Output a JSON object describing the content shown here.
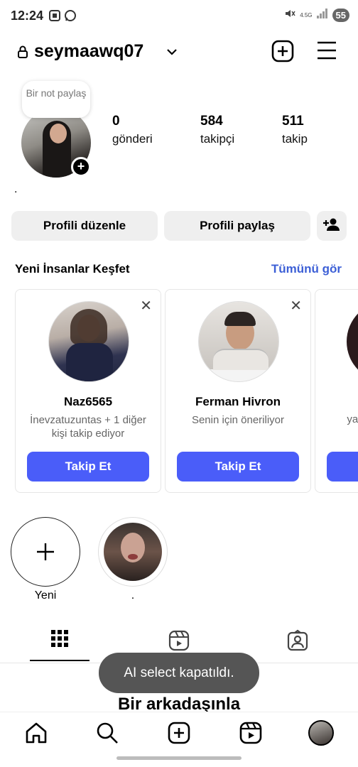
{
  "status_bar": {
    "time": "12:24",
    "network": "4.5G",
    "battery": "55"
  },
  "profile": {
    "username": "seymaawq07",
    "note": "Bir not paylaş",
    "bio": "."
  },
  "stats": [
    {
      "value": "0",
      "label": "gönderi"
    },
    {
      "value": "584",
      "label": "takipçi"
    },
    {
      "value": "511",
      "label": "takip"
    }
  ],
  "buttons": {
    "edit_profile": "Profili düzenle",
    "share_profile": "Profili paylaş"
  },
  "discover": {
    "title": "Yeni İnsanlar Keşfet",
    "see_all": "Tümünü gör",
    "cards": [
      {
        "name": "Naz6565",
        "subtitle": "İnevzatuzuntas + 1 diğer kişi takip ediyor",
        "button": "Takip Et"
      },
      {
        "name": "Ferman Hivron",
        "subtitle": "Senin için öneriliyor",
        "button": "Takip Et"
      },
      {
        "name": "",
        "subtitle": "yagz",
        "button": ""
      }
    ]
  },
  "highlights": [
    {
      "label": "Yeni"
    },
    {
      "label": "."
    }
  ],
  "toast": "AI select kapatıldı.",
  "section_title": "Bir arkadaşınla"
}
